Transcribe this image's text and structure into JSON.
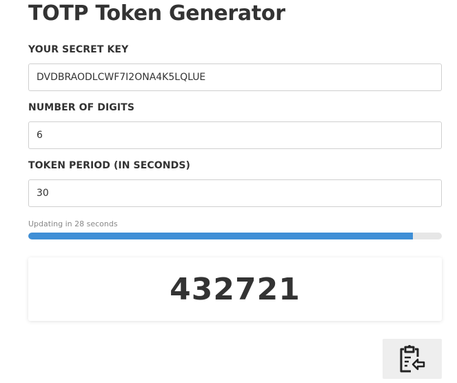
{
  "app": {
    "title": "TOTP Token Generator"
  },
  "fields": {
    "secret": {
      "label": "YOUR SECRET KEY",
      "value": "DVDBRAODLCWF7I2ONA4K5LQLUE"
    },
    "digits": {
      "label": "NUMBER OF DIGITS",
      "value": "6"
    },
    "period": {
      "label": "TOKEN PERIOD (IN SECONDS)",
      "value": "30"
    }
  },
  "progress": {
    "text": "Updating in 28 seconds",
    "fraction": 0.93
  },
  "token": {
    "value": "432721"
  },
  "copy_button": {
    "icon": "clipboard-copy-icon"
  },
  "colors": {
    "progress_fill": "#3f8fd6",
    "progress_track": "#e6e6e6",
    "text": "#333333"
  }
}
